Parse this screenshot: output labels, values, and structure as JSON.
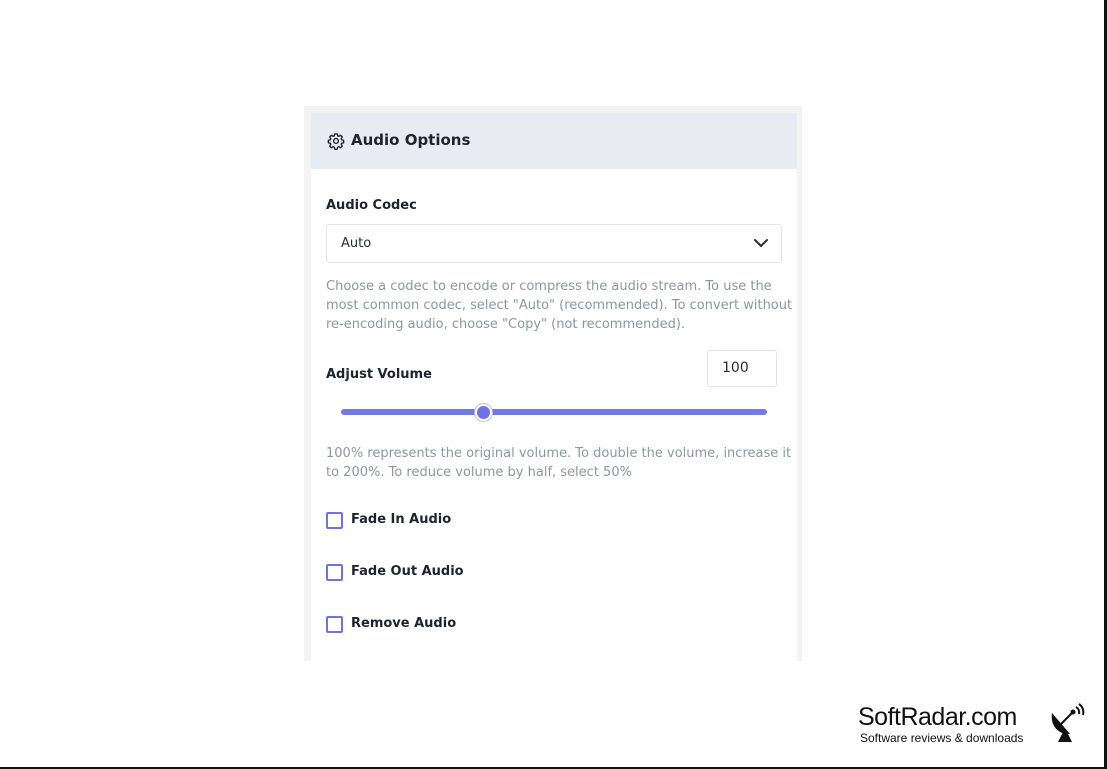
{
  "panel": {
    "title": "Audio Options",
    "icon": "gear-icon"
  },
  "audio_codec": {
    "label": "Audio Codec",
    "selected": "Auto",
    "help_lines": [
      "Choose a codec to encode or compress the audio stream. To use the",
      "most common codec, select \"Auto\" (recommended). To convert without",
      "re-encoding audio, choose \"Copy\" (not recommended)."
    ]
  },
  "volume": {
    "label": "Adjust Volume",
    "value": "100",
    "slider_fraction": 0.333,
    "help_lines": [
      "100% represents the original volume. To double the volume, increase it",
      "to 200%. To reduce volume by half, select 50%"
    ]
  },
  "options": [
    {
      "label": "Fade In Audio",
      "checked": false
    },
    {
      "label": "Fade Out Audio",
      "checked": false
    },
    {
      "label": "Remove Audio",
      "checked": false
    }
  ],
  "colors": {
    "accent": "#6c73e5",
    "header_bg": "#e8ebf2",
    "help_text": "#8f95a3"
  },
  "watermark": {
    "name": "SoftRadar.com",
    "tagline": "Software reviews & downloads"
  }
}
